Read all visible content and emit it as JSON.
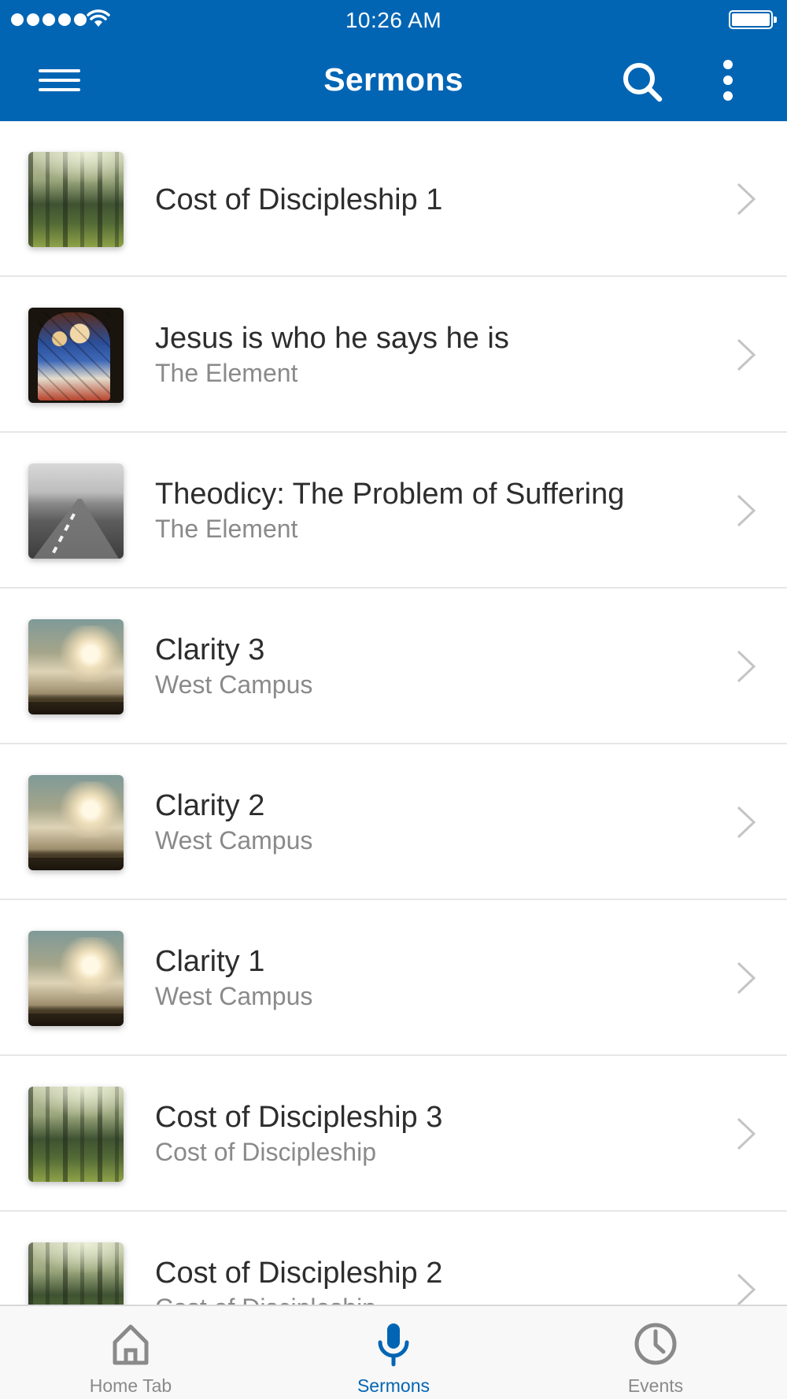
{
  "status_bar": {
    "time": "10:26 AM"
  },
  "app_bar": {
    "title": "Sermons",
    "icons": [
      "menu-icon",
      "search-icon",
      "more-vert-icon"
    ]
  },
  "sermons": [
    {
      "title": "Cost of Discipleship 1",
      "subtitle": "",
      "thumbnail": "forest"
    },
    {
      "title": "Jesus is who he says he is",
      "subtitle": "The Element",
      "thumbnail": "stained-glass"
    },
    {
      "title": "Theodicy: The Problem of Suffering",
      "subtitle": "The Element",
      "thumbnail": "road"
    },
    {
      "title": "Clarity 3",
      "subtitle": "West Campus",
      "thumbnail": "clouds"
    },
    {
      "title": "Clarity 2",
      "subtitle": "West Campus",
      "thumbnail": "clouds"
    },
    {
      "title": "Clarity 1",
      "subtitle": "West Campus",
      "thumbnail": "clouds"
    },
    {
      "title": "Cost of Discipleship 3",
      "subtitle": "Cost of Discipleship",
      "thumbnail": "forest"
    },
    {
      "title": "Cost of Discipleship 2",
      "subtitle": "Cost of Discipleship",
      "thumbnail": "forest"
    }
  ],
  "tabs": [
    {
      "label": "Home Tab",
      "icon": "home-icon",
      "active": false
    },
    {
      "label": "Sermons",
      "icon": "microphone-icon",
      "active": true
    },
    {
      "label": "Events",
      "icon": "clock-icon",
      "active": false
    }
  ],
  "colors": {
    "primary": "#0265b4",
    "title_text": "#2d2d2d",
    "subtitle_text": "#8a8a8a",
    "divider": "#e6e6e6",
    "tab_inactive": "#8a8a8a"
  }
}
